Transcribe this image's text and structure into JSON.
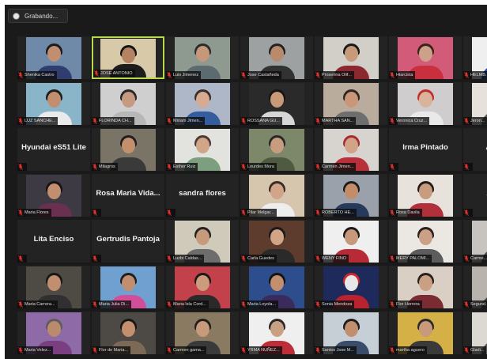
{
  "recording": {
    "label": "Grabando..."
  },
  "colors": {
    "active_speaker_border": "#b7da4a",
    "muted_mic": "#e2342c",
    "tile_bg": "#232323"
  },
  "participants": [
    {
      "name": "Shenika Castro",
      "video": true,
      "bg": "#6f8aa8",
      "hair": "#1b1b1b",
      "skin": "#c18f70",
      "shirt": "#2f3e6e"
    },
    {
      "name": "JOSE ANTONIO",
      "video": true,
      "active": true,
      "bg": "#d8c9a8",
      "hair": "#151515",
      "skin": "#b48362",
      "shirt": "#1d1d1d"
    },
    {
      "name": "Luis Jimenez",
      "video": true,
      "bg": "#8e9a8f",
      "hair": "#2b2b2b",
      "skin": "#c7977a",
      "shirt": "#5b6b70"
    },
    {
      "name": "Jose Castañeda",
      "video": true,
      "bg": "#9ea1a2",
      "hair": "#222222",
      "skin": "#b98b6c",
      "shirt": "#323232"
    },
    {
      "name": "Proserina Olif...",
      "video": true,
      "bg": "#d2cfc9",
      "hair": "#191919",
      "skin": "#c79a7c",
      "shirt": "#8b2830"
    },
    {
      "name": "Hiarcista",
      "video": true,
      "bg": "#d25b7a",
      "hair": "#3a2319",
      "skin": "#cda08a",
      "shirt": "#c92f3d"
    },
    {
      "name": "HELMB...",
      "video": true,
      "bg": "#efefef",
      "hair": "#b8252e",
      "skin": "#e8e8e8",
      "shirt": "#1f4aa0"
    },
    {
      "name": "LUZ SANCHE...",
      "video": true,
      "bg": "#8ab4c7",
      "hair": "#1f1f1f",
      "skin": "#c18f70",
      "shirt": "#eaeaea"
    },
    {
      "name": "FLORINDA CH...",
      "video": true,
      "bg": "#cfcfcf",
      "hair": "#282828",
      "skin": "#c69a80",
      "shirt": "#b7b7b7"
    },
    {
      "name": "Miriam Jimen...",
      "video": true,
      "bg": "#aeb7c8",
      "hair": "#3a2e2a",
      "skin": "#d6ab92",
      "shirt": "#355c9c"
    },
    {
      "name": "ROSSANA GU...",
      "video": true,
      "bg": "#2a2a2a",
      "hair": "#161616",
      "skin": "#c99a78",
      "shirt": "#d7d7d7"
    },
    {
      "name": "MARTHA SAN...",
      "video": true,
      "bg": "#b9ac9c",
      "hair": "#2f2420",
      "skin": "#c9967a",
      "shirt": "#6e6e6e"
    },
    {
      "name": "Veronica Cruz...",
      "video": true,
      "bg": "#cfcdcd",
      "hair": "#c32e2e",
      "skin": "#dab39c",
      "shirt": "#e9e9e9"
    },
    {
      "name": "Jeron...",
      "video": true,
      "bg": "#e6e1da",
      "hair": "#2a2a2a",
      "skin": "#c89a7d",
      "shirt": "#5a5a5a"
    },
    {
      "name": "Hyundai eS51 Lite",
      "video": false
    },
    {
      "name": "Milagros",
      "video": true,
      "bg": "#7a7466",
      "hair": "#1e1e1e",
      "skin": "#c38f6d",
      "shirt": "#3a3a3a"
    },
    {
      "name": "Esther Ruiz",
      "video": true,
      "bg": "#e2e2de",
      "hair": "#4a3a30",
      "skin": "#d1a588",
      "shirt": "#7d9f7f"
    },
    {
      "name": "Lourdes Mora",
      "video": true,
      "bg": "#7d8769",
      "hair": "#272727",
      "skin": "#c89c7e",
      "shirt": "#505a40"
    },
    {
      "name": "Carmen Jimen...",
      "video": true,
      "bg": "#d7d3cf",
      "hair": "#a82a2f",
      "skin": "#d1a389",
      "shirt": "#b8313a"
    },
    {
      "name": "Irma Pintado",
      "video": false
    },
    {
      "name": "Anton...",
      "video": false
    },
    {
      "name": "Maria Flores",
      "video": true,
      "bg": "#3d3a44",
      "hair": "#151515",
      "skin": "#c18f70",
      "shirt": "#6a3050"
    },
    {
      "name": "Rosa Maria Vida...",
      "video": false
    },
    {
      "name": "sandra flores",
      "video": false
    },
    {
      "name": "Pilar Melgar...",
      "video": true,
      "bg": "#d6c6ad",
      "hair": "#3b2b22",
      "skin": "#d1a589",
      "shirt": "#eeeeee"
    },
    {
      "name": "ROBERTO HE...",
      "video": true,
      "bg": "#9aa1aa",
      "hair": "#1c1c1c",
      "skin": "#c38d6b",
      "shirt": "#273a5c"
    },
    {
      "name": "Rosa Davila",
      "video": true,
      "bg": "#e7e2dc",
      "hair": "#251b17",
      "skin": "#c89c7f",
      "shirt": "#b0303b"
    },
    {
      "name": "Alicia...",
      "video": false
    },
    {
      "name": "Lita Enciso",
      "video": false
    },
    {
      "name": "Gertrudis Pantoja",
      "video": false
    },
    {
      "name": "Luzbi Caldas...",
      "video": true,
      "bg": "#cfcab9",
      "hair": "#222222",
      "skin": "#c89a7c",
      "shirt": "#6d6d6d"
    },
    {
      "name": "Carla Guedes",
      "video": true,
      "bg": "#5d3b2d",
      "hair": "#1a1a1a",
      "skin": "#d2a587",
      "shirt": "#2a2a2a"
    },
    {
      "name": "WENY FINO",
      "video": true,
      "bg": "#efefef",
      "hair": "#1b1b1b",
      "skin": "#c8987b",
      "shirt": "#b62b36"
    },
    {
      "name": "MERY PALOMI...",
      "video": true,
      "bg": "#ebe7e3",
      "hair": "#2b211d",
      "skin": "#caa185",
      "shirt": "#5c5c5c"
    },
    {
      "name": "Carme...",
      "video": true,
      "bg": "#c7c4bf",
      "hair": "#2b2b2b",
      "skin": "#c8997a",
      "shirt": "#4c4c4c"
    },
    {
      "name": "Maria Carrera...",
      "video": true,
      "bg": "#4e4a44",
      "hair": "#181818",
      "skin": "#c18f70",
      "shirt": "#303030"
    },
    {
      "name": "Maria Julia Di...",
      "video": true,
      "bg": "#6fa0cf",
      "hair": "#1f1f1f",
      "skin": "#c18f70",
      "shirt": "#d04f98"
    },
    {
      "name": "Maria Isla Cord...",
      "video": true,
      "bg": "#c2414a",
      "hair": "#201815",
      "skin": "#cc9b7e",
      "shirt": "#2a2a2a"
    },
    {
      "name": "Maria Loyola...",
      "video": true,
      "bg": "#2e4d8c",
      "hair": "#141414",
      "skin": "#c38f6f",
      "shirt": "#3b2b5c"
    },
    {
      "name": "Sonia Mendoza",
      "video": true,
      "bg": "#1f2a5c",
      "hair": "#ce2a2a",
      "skin": "#e7e7e7",
      "shirt": "#b9232f"
    },
    {
      "name": "Flor Herrera",
      "video": true,
      "bg": "#d9cfc4",
      "hair": "#2b211c",
      "skin": "#caa084",
      "shirt": "#7a2c32"
    },
    {
      "name": "Segund...",
      "video": true,
      "bg": "#b8b3ad",
      "hair": "#222222",
      "skin": "#c18f70",
      "shirt": "#444444"
    },
    {
      "name": "Maria Velez...",
      "video": true,
      "bg": "#8e6aa6",
      "hair": "#5c5c5c",
      "skin": "#b98a6b",
      "shirt": "#7a3f80"
    },
    {
      "name": "Flor de Maria...",
      "video": true,
      "bg": "#4d4a45",
      "hair": "#161616",
      "skin": "#c38f6f",
      "shirt": "#7c6a56"
    },
    {
      "name": "Carmen gama...",
      "video": true,
      "bg": "#8a7a62",
      "hair": "#1f1f1f",
      "skin": "#c89a7c",
      "shirt": "#3a3a3a"
    },
    {
      "name": "YRMA NUÑEZ...",
      "video": true,
      "bg": "#efefef",
      "hair": "#2a2a2a",
      "skin": "#caa084",
      "shirt": "#bd2f38"
    },
    {
      "name": "Santos Jose M...",
      "video": true,
      "bg": "#c7cfd6",
      "hair": "#1c1c1c",
      "skin": "#c18f70",
      "shirt": "#3a4c6a"
    },
    {
      "name": "martha aguero",
      "video": true,
      "bg": "#d4b047",
      "hair": "#2a2a2a",
      "skin": "#c8997b",
      "shirt": "#3a3a3a"
    },
    {
      "name": "Gladi...",
      "video": true,
      "bg": "#dcd8d2",
      "hair": "#252525",
      "skin": "#c89b7e",
      "shirt": "#5a5a5a"
    }
  ]
}
